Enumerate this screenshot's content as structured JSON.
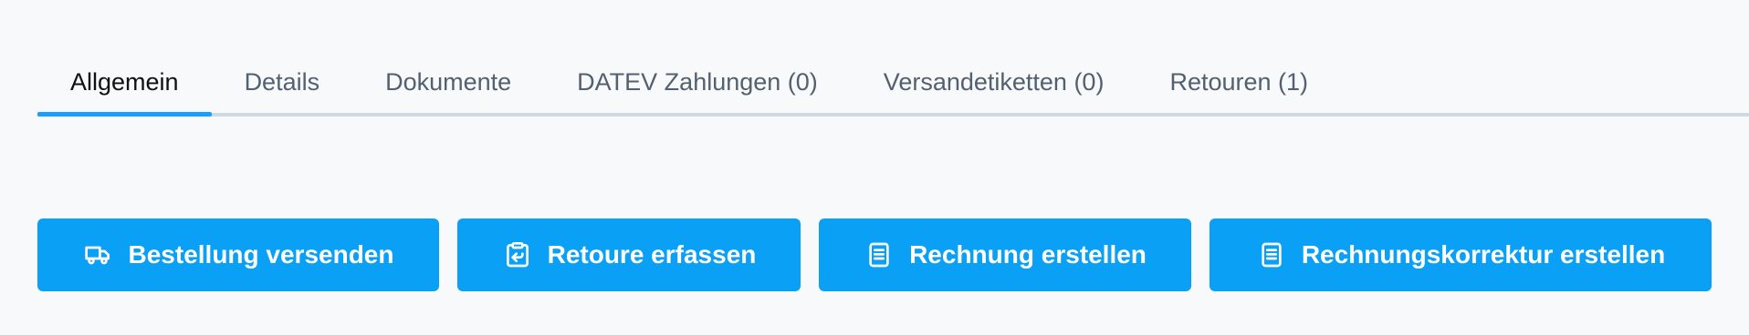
{
  "tabs": [
    {
      "label": "Allgemein",
      "active": true
    },
    {
      "label": "Details",
      "active": false
    },
    {
      "label": "Dokumente",
      "active": false
    },
    {
      "label": "DATEV Zahlungen (0)",
      "active": false
    },
    {
      "label": "Versandetiketten (0)",
      "active": false
    },
    {
      "label": "Retouren (1)",
      "active": false
    }
  ],
  "actions": {
    "ship_order": {
      "label": "Bestellung versenden",
      "icon": "truck-icon"
    },
    "record_return": {
      "label": "Retoure erfassen",
      "icon": "return-clipboard-icon"
    },
    "create_invoice": {
      "label": "Rechnung erstellen",
      "icon": "document-icon"
    },
    "create_invoice_correction": {
      "label": "Rechnungskorrektur erstellen",
      "icon": "document-icon"
    }
  },
  "colors": {
    "accent": "#189eff",
    "button": "#0aa0f6",
    "tab_inactive": "#52606f",
    "tab_active": "#111111",
    "tab_border": "#cfd9e3",
    "background": "#f8f9fb"
  }
}
